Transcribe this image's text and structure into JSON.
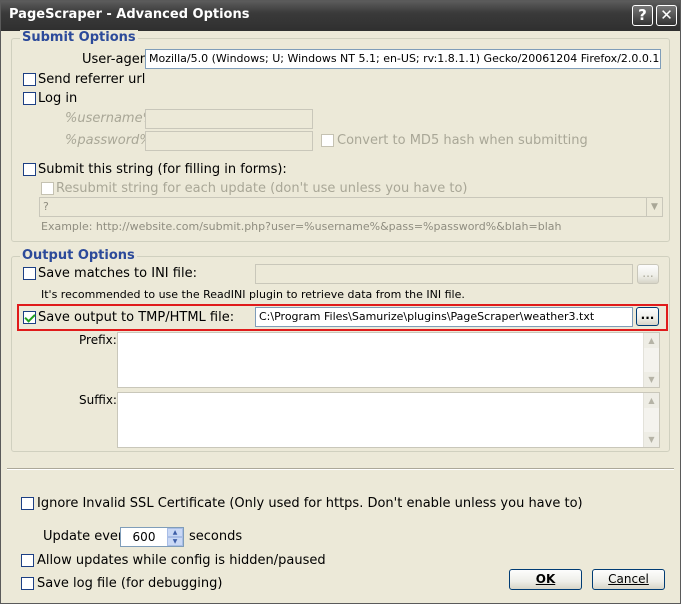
{
  "window": {
    "title": "PageScraper - Advanced Options",
    "help_glyph": "?",
    "close_glyph": "✕"
  },
  "submit_options": {
    "legend": "Submit Options",
    "user_agent_label": "User-agent",
    "user_agent_value": "Mozilla/5.0 (Windows; U; Windows NT 5.1; en-US; rv:1.8.1.1) Gecko/20061204 Firefox/2.0.0.1",
    "send_referrer_label": "Send referrer url",
    "log_in_label": "Log in",
    "username_placeholder": "%username%",
    "password_placeholder": "%password%",
    "md5_label": "Convert to MD5 hash when submitting",
    "submit_string_label": "Submit this string (for filling in forms):",
    "resubmit_label": "Resubmit string for each update (don't use unless you have to)",
    "submit_string_value": "?",
    "example_text": "Example: http://website.com/submit.php?user=%username%&pass=%password%&blah=blah"
  },
  "output_options": {
    "legend": "Output Options",
    "save_ini_label": "Save matches to INI file:",
    "ini_note": "It's recommended to use the ReadINI plugin to retrieve data from the INI file.",
    "browse_label": "...",
    "save_tmp_label": "Save output to TMP/HTML file:",
    "tmp_path": "C:\\Program Files\\Samurize\\plugins\\PageScraper\\weather3.txt",
    "prefix_label": "Prefix:",
    "suffix_label": "Suffix:"
  },
  "bottom": {
    "ignore_ssl_label": "Ignore Invalid SSL Certificate (Only used for https. Don't enable unless you have to)",
    "update_every_label": "Update every",
    "update_value": "600",
    "seconds_label": "seconds",
    "allow_updates_label": "Allow updates while config is hidden/paused",
    "save_log_label": "Save log file (for debugging)",
    "ok_label": "OK",
    "cancel_label": "Cancel"
  },
  "colors": {
    "legend_text": "#2c4a9a",
    "highlight_border": "#e01b1b",
    "dialog_bg": "#ece9d8"
  }
}
